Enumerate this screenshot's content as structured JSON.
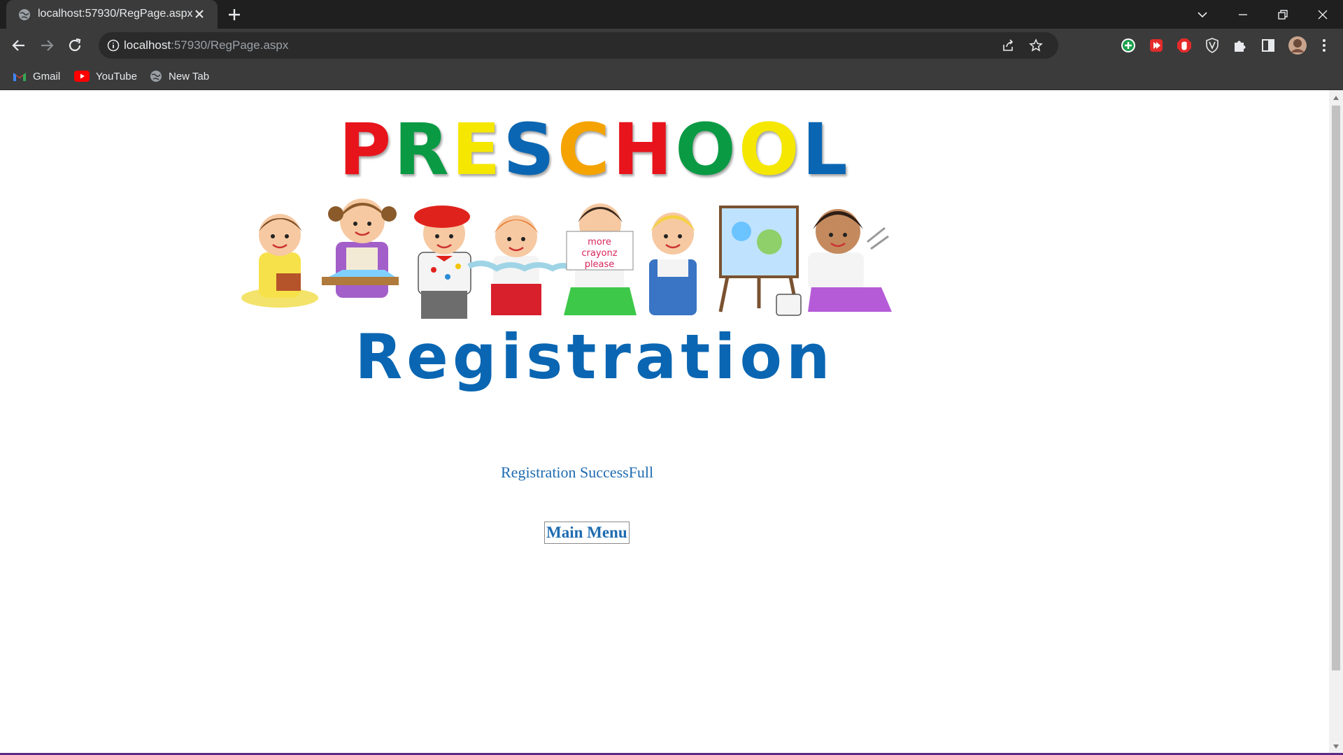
{
  "browser": {
    "tab_title": "localhost:57930/RegPage.aspx",
    "url_host": "localhost",
    "url_rest": ":57930/RegPage.aspx",
    "bookmarks": [
      {
        "label": "Gmail",
        "icon": "gmail-icon"
      },
      {
        "label": "YouTube",
        "icon": "youtube-icon"
      },
      {
        "label": "New Tab",
        "icon": "globe-icon"
      }
    ]
  },
  "page": {
    "banner_top": "PRESCHOOL",
    "banner_bottom": "Registration",
    "banner_letter_colors": [
      "#e8141b",
      "#0a9a44",
      "#f5e700",
      "#0a66b2",
      "#f4a300",
      "#e8141b",
      "#0a9a44",
      "#f5e700",
      "#0a66b2"
    ],
    "crayon_text": "more crayonz please",
    "status_message": "Registration SuccessFull",
    "main_menu_button": "Main Menu"
  },
  "colors": {
    "chrome_dark": "#1f1f1f",
    "chrome_toolbar": "#3b3b3b",
    "link_blue": "#1e6bb0",
    "registration_blue": "#0a66b2"
  }
}
